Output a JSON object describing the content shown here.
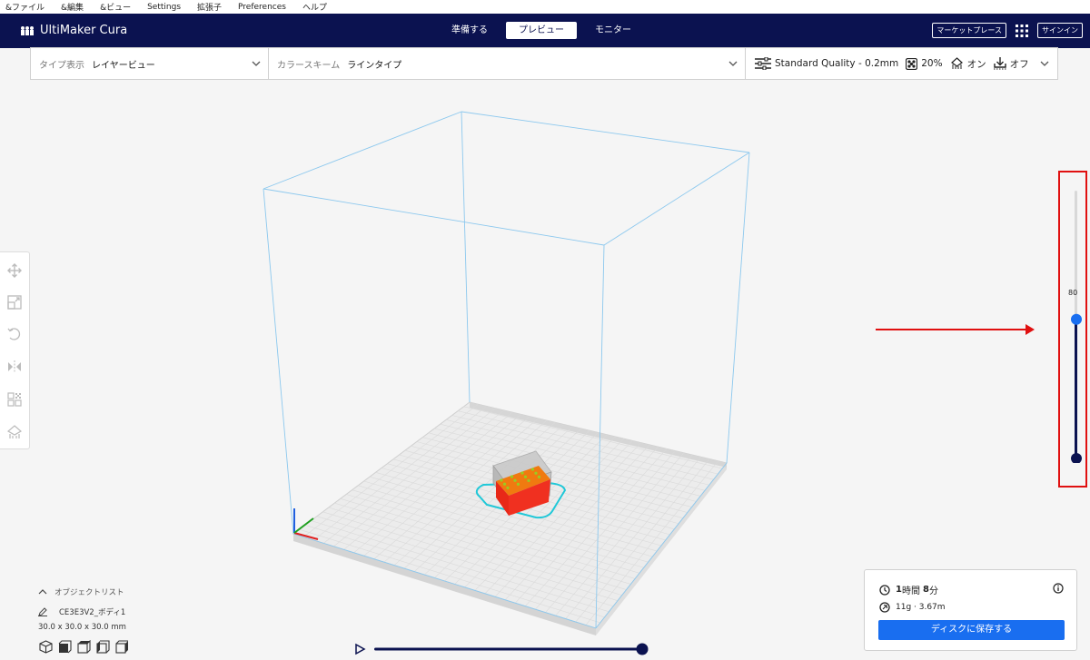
{
  "menu": [
    "&ファイル",
    "&編集",
    "&ビュー",
    "Settings",
    "拡張子",
    "Preferences",
    "ヘルプ"
  ],
  "app": {
    "name": "UltiMaker Cura"
  },
  "stages": [
    {
      "label": "準備する",
      "active": false
    },
    {
      "label": "プレビュー",
      "active": true
    },
    {
      "label": "モニター",
      "active": false
    }
  ],
  "header_right": {
    "marketplace": "マーケットプレース",
    "signin": "サインイン"
  },
  "toolbar": {
    "view_type_label": "タイプ表示",
    "view_type_value": "レイヤービュー",
    "color_scheme_label": "カラースキーム",
    "color_scheme_value": "ラインタイプ",
    "quality": "Standard Quality - 0.2mm",
    "infill": "20%",
    "support": "オン",
    "adhesion": "オフ"
  },
  "layer_slider": {
    "current_layer": "80",
    "max_layer": 150,
    "min_layer": 1
  },
  "object_list": {
    "title": "オブジェクトリスト",
    "object_name": "CE3E3V2_ボディ1",
    "dimensions": "30.0 x 30.0 x 30.0 mm"
  },
  "print_info": {
    "time_hours": "1",
    "time_hours_unit": "時間",
    "time_minutes": "8",
    "time_minutes_unit": "分",
    "material": "11g · 3.67m",
    "save_button": "ディスクに保存する"
  },
  "colors": {
    "header_bg": "#0b1250",
    "accent_blue": "#196ef0",
    "annotation_red": "#e01010",
    "slider_dark": "#0b1250"
  }
}
